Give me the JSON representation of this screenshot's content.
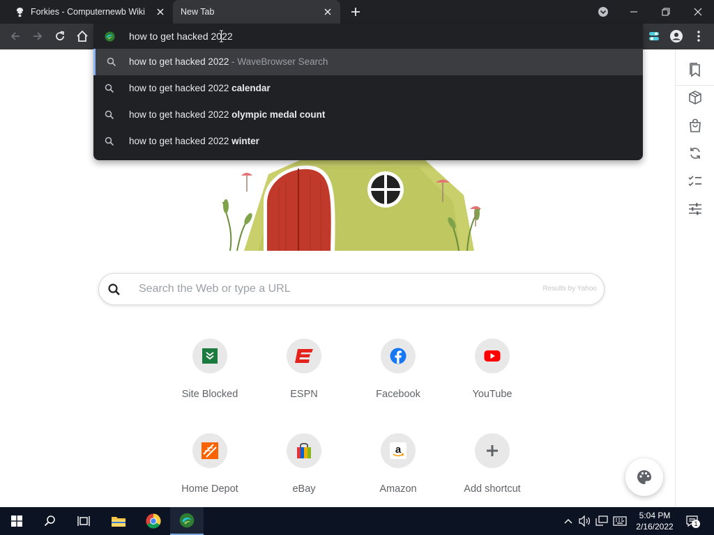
{
  "tabs": [
    {
      "title": "Forkies - Computernewb Wiki",
      "active": false
    },
    {
      "title": "New Tab",
      "active": true
    }
  ],
  "omnibox": {
    "input_value": "how to get hacked 2022",
    "suggestions": [
      {
        "base": "how to get hacked 2022",
        "bold": "",
        "suffix": " - WaveBrowser Search",
        "selected": true
      },
      {
        "base": "how to get hacked 2022 ",
        "bold": "calendar",
        "suffix": "",
        "selected": false
      },
      {
        "base": "how to get hacked 2022 ",
        "bold": "olympic medal count",
        "suffix": "",
        "selected": false
      },
      {
        "base": "how to get hacked 2022 ",
        "bold": "winter",
        "suffix": "",
        "selected": false
      }
    ]
  },
  "search": {
    "placeholder": "Search the Web or type a URL",
    "powered_by": "Results by Yahoo"
  },
  "shortcuts": [
    {
      "label": "Site Blocked",
      "icon": "site-blocked-icon"
    },
    {
      "label": "ESPN",
      "icon": "espn-icon"
    },
    {
      "label": "Facebook",
      "icon": "facebook-icon"
    },
    {
      "label": "YouTube",
      "icon": "youtube-icon"
    },
    {
      "label": "Home Depot",
      "icon": "home-depot-icon"
    },
    {
      "label": "eBay",
      "icon": "ebay-icon"
    },
    {
      "label": "Amazon",
      "icon": "amazon-icon"
    },
    {
      "label": "Add shortcut",
      "icon": "plus-icon"
    }
  ],
  "taskbar": {
    "time": "5:04 PM",
    "date": "2/16/2022",
    "notification_count": "1"
  },
  "colors": {
    "tab_strip": "#202124",
    "toolbar": "#35363a",
    "taskbar": "#0c1322",
    "accent": "#8ab4f8"
  }
}
